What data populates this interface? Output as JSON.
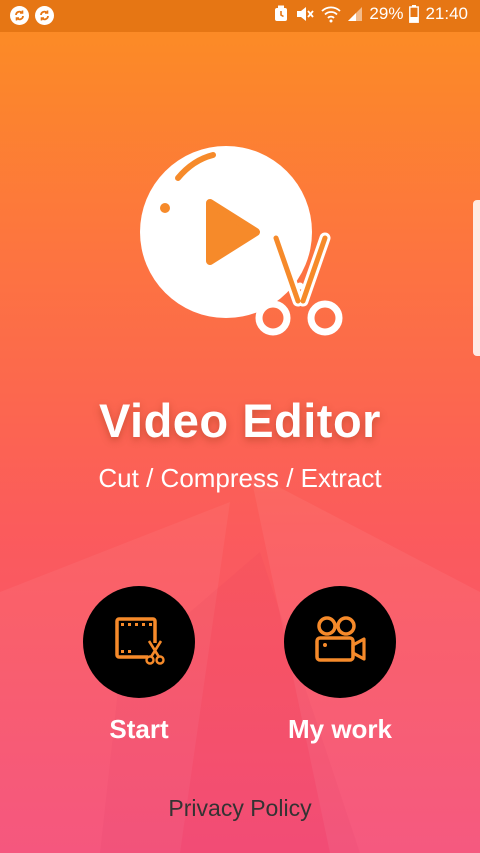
{
  "status_bar": {
    "battery": "29%",
    "time": "21:40",
    "icons": [
      "sync-icon",
      "sync-icon",
      "alarm-icon",
      "mute-icon",
      "wifi-icon",
      "signal-icon",
      "battery-icon"
    ]
  },
  "app": {
    "title": "Video Editor",
    "subtitle": "Cut / Compress / Extract",
    "logo_icon": "video-play-scissors-icon"
  },
  "actions": [
    {
      "label": "Start",
      "icon": "film-cut-icon"
    },
    {
      "label": "My work",
      "icon": "video-camera-icon"
    }
  ],
  "footer": {
    "privacy_label": "Privacy Policy"
  },
  "colors": {
    "accent": "#f68a2a",
    "gradient_top": "#fc8e22",
    "gradient_bottom": "#f54f78",
    "status_bar": "#e67614",
    "button_bg": "#000000"
  }
}
